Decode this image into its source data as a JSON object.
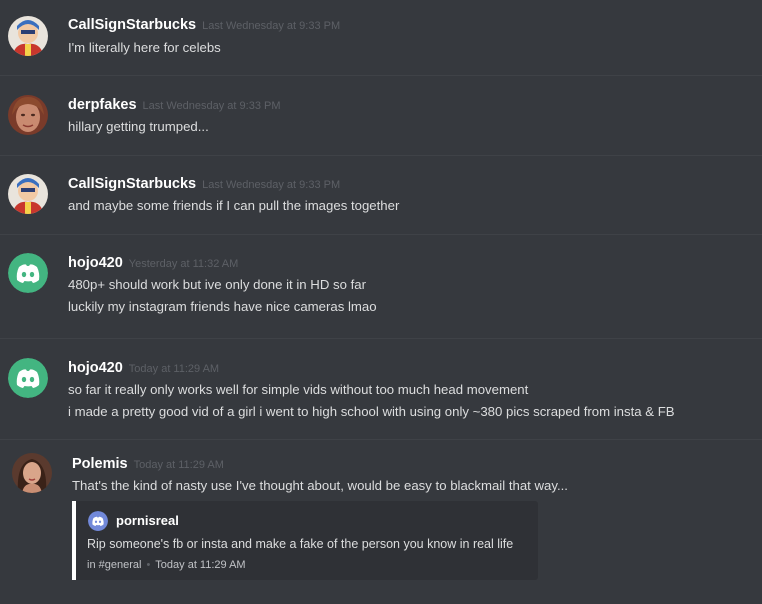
{
  "messages": [
    {
      "username": "CallSignStarbucks",
      "timestamp": "Last Wednesday at 9:33 PM",
      "avatar_icon": "starbucks-avatar",
      "lines": [
        "I'm literally here for celebs"
      ]
    },
    {
      "username": "derpfakes",
      "timestamp": "Last Wednesday at 9:33 PM",
      "avatar_icon": "face-photo-avatar",
      "lines": [
        "hillary getting trumped..."
      ]
    },
    {
      "username": "CallSignStarbucks",
      "timestamp": "Last Wednesday at 9:33 PM",
      "avatar_icon": "starbucks-avatar",
      "lines": [
        "and maybe some friends if I can pull the images together"
      ]
    },
    {
      "username": "hojo420",
      "timestamp": "Yesterday at 11:32 AM",
      "avatar_icon": "discord-default-avatar",
      "lines": [
        "480p+ should work but ive only done it in HD so far",
        "luckily my instagram friends have nice cameras lmao"
      ]
    },
    {
      "username": "hojo420",
      "timestamp": "Today at 11:29 AM",
      "avatar_icon": "discord-default-avatar",
      "lines": [
        "so far it really only works well for simple vids without too much head movement",
        "i made a pretty good vid of a girl i went to high school with using only ~380 pics scraped from insta & FB"
      ]
    },
    {
      "username": "Polemis",
      "timestamp": "Today at 11:29 AM",
      "avatar_icon": "photo-avatar",
      "lines": [
        "That's the kind of nasty use I've thought about, would be easy to blackmail that way..."
      ]
    }
  ],
  "embed": {
    "author": "pornisreal",
    "author_icon": "discord-default-avatar",
    "description": "Rip someone's fb or insta and make a fake of the person you know in real life",
    "footer_channel": "in #general",
    "footer_separator": "•",
    "footer_time": "Today at 11:29 AM"
  },
  "colors": {
    "background": "#36393e",
    "username": "#ffffff",
    "timestamp": "#5d6066",
    "text": "#dcddde",
    "discord_green": "#43b581",
    "discord_blurple": "#7289da"
  }
}
